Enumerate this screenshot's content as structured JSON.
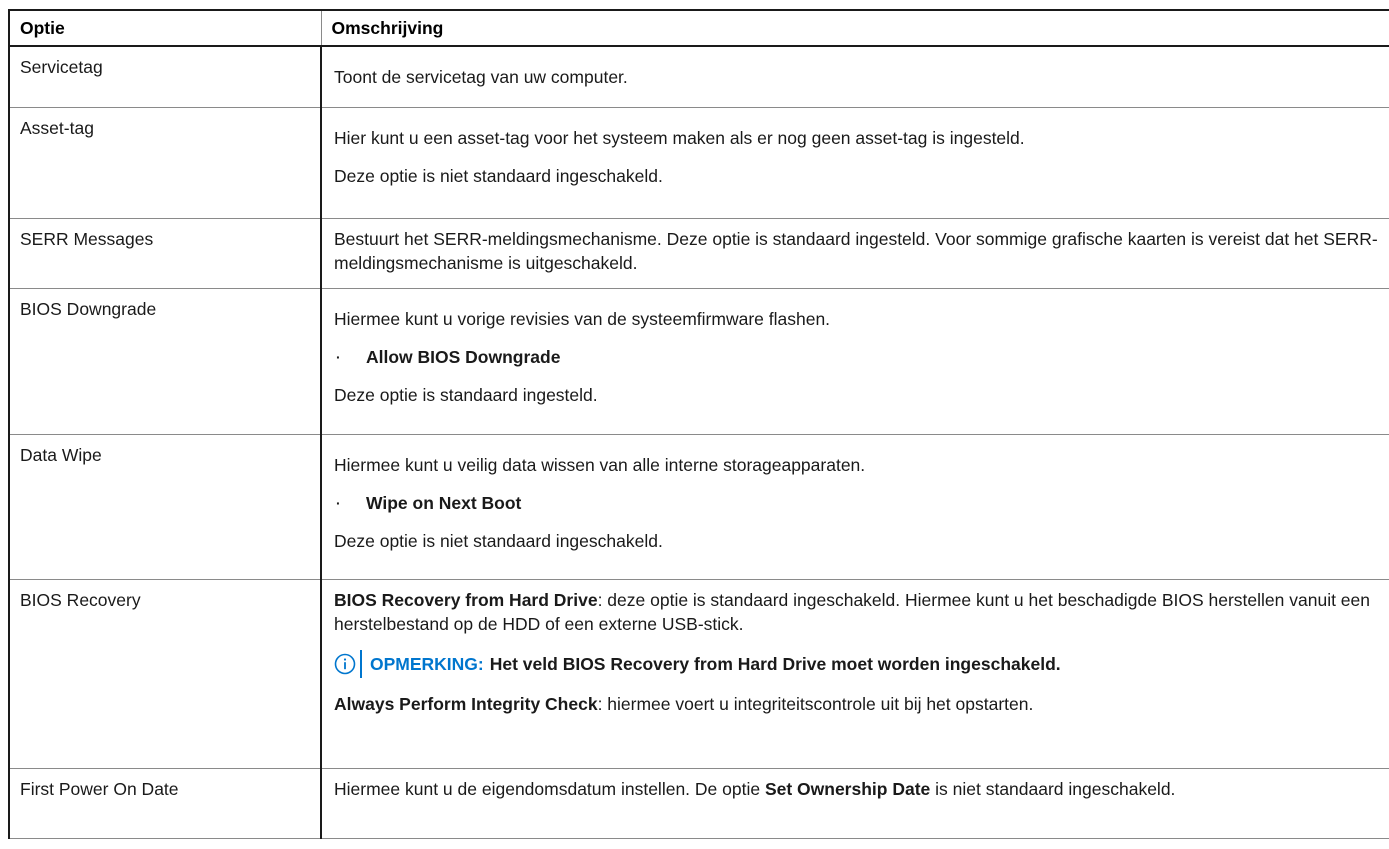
{
  "header": {
    "col1": "Optie",
    "col2": "Omschrijving"
  },
  "rows": [
    {
      "name": "Servicetag",
      "desc": [
        "Toont de servicetag van uw computer."
      ]
    },
    {
      "name": "Asset-tag",
      "desc": [
        "Hier kunt u een asset-tag voor het systeem maken als er nog geen asset-tag is ingesteld.",
        "Deze optie is niet standaard ingeschakeld."
      ]
    },
    {
      "name": "SERR Messages",
      "desc": [
        "Bestuurt het SERR-meldingsmechanisme. Deze optie is standaard ingesteld. Voor sommige grafische kaarten is vereist dat het SERR-meldingsmechanisme is uitgeschakeld."
      ]
    },
    {
      "name": "BIOS Downgrade",
      "intro": "Hiermee kunt u vorige revisies van de systeemfirmware flashen.",
      "bullet": "Allow BIOS Downgrade",
      "outro": "Deze optie is standaard ingesteld."
    },
    {
      "name": "Data Wipe",
      "intro": "Hiermee kunt u veilig data wissen van alle interne storageapparaten.",
      "bullet": "Wipe on Next Boot",
      "outro": "Deze optie is niet standaard ingeschakeld."
    },
    {
      "name": "BIOS Recovery",
      "p1_bold": "BIOS Recovery from Hard Drive",
      "p1_rest": ": deze optie is standaard ingeschakeld. Hiermee kunt u het beschadigde BIOS herstellen vanuit een herstelbestand op de HDD of een externe USB-stick.",
      "note_label": "OPMERKING:",
      "note_text": "Het veld BIOS Recovery from Hard Drive moet worden ingeschakeld.",
      "p2_bold": "Always Perform Integrity Check",
      "p2_rest": ": hiermee voert u integriteitscontrole uit bij het opstarten."
    },
    {
      "name": "First Power On Date",
      "p_start": "Hiermee kunt u de eigendomsdatum instellen. De optie ",
      "p_bold": "Set Ownership Date",
      "p_end": " is niet standaard ingeschakeld."
    }
  ],
  "icons": {
    "note_icon": "info-circle-icon",
    "bullet": "·"
  },
  "colors": {
    "note_accent": "#0076ce",
    "border_dark": "#1a1a1a",
    "border_light": "#8a8a8a"
  }
}
